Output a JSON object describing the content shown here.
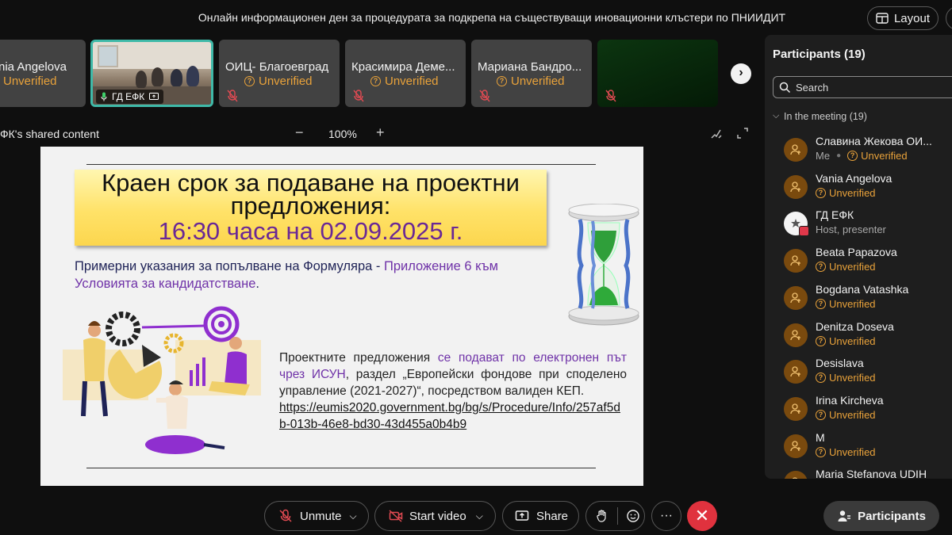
{
  "meeting": {
    "title": "Онлайн информационен ден за процедурата за подкрепа на съществуващи иновационни клъстери по ПНИИДИТ",
    "layout_label": "Layout"
  },
  "tiles": [
    {
      "name": "nia Angelova",
      "status": "Unverified"
    },
    {
      "name": "ГД ЕФК"
    },
    {
      "name": "ОИЦ- Благоевград",
      "status": "Unverified"
    },
    {
      "name": "Красимира Деме...",
      "status": "Unverified"
    },
    {
      "name": "Мариана Бандро...",
      "status": "Unverified"
    }
  ],
  "share": {
    "label": "ФК's shared content",
    "zoom": "100%",
    "zoom_minus": "−",
    "zoom_plus": "+"
  },
  "slide": {
    "deadline_title": "Краен срок за подаване на проектни предложения:",
    "deadline_time": "16:30 часа на 02.09.2025 г.",
    "guide_plain": "Примерни указания за попълване на Формуляра - ",
    "guide_purple": "Приложение 6 към Условията за кандидатстване",
    "guide_end": ".",
    "body_a": "Проектните предложения ",
    "body_b": "се подават по електронен път чрез ИСУН",
    "body_c": ", раздел „Европейски фондове при споделено управление (2021-2027)“, посредством валиден КЕП.",
    "link": "https://eumis2020.government.bg/bg/s/Procedure/Info/257af5db-013b-46e8-bd30-43d455a0b4b9"
  },
  "panel": {
    "title": "Participants (19)",
    "search_placeholder": "Search",
    "group_label": "In the meeting (19)",
    "participants": [
      {
        "name": "Славина Жекова ОИ...",
        "me": "Me",
        "status": "Unverified"
      },
      {
        "name": "Vania Angelova",
        "status": "Unverified"
      },
      {
        "name": "ГД ЕФК",
        "role": "Host, presenter"
      },
      {
        "name": "Beata Papazova",
        "status": "Unverified"
      },
      {
        "name": "Bogdana Vatashka",
        "status": "Unverified"
      },
      {
        "name": "Denitza Doseva",
        "status": "Unverified"
      },
      {
        "name": "Desislava",
        "status": "Unverified"
      },
      {
        "name": "Irina Kircheva",
        "status": "Unverified"
      },
      {
        "name": "M",
        "status": "Unverified"
      },
      {
        "name": "Maria Stefanova UDIH"
      }
    ]
  },
  "toolbar": {
    "unmute": "Unmute",
    "start_video": "Start video",
    "share": "Share",
    "participants": "Participants",
    "more": "···"
  },
  "colors": {
    "accent_teal": "#3fb9a8",
    "unverified": "#e9a23a",
    "leave": "#e0323e",
    "slide_purple": "#6f32a8"
  }
}
